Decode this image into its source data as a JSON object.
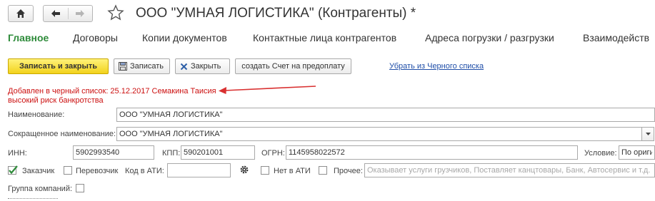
{
  "window": {
    "title": "ООО \"УМНАЯ ЛОГИСТИКА\" (Контрагенты) *"
  },
  "icons": {
    "home": "home-icon",
    "back": "arrow-left-icon",
    "forward": "arrow-right-icon",
    "favorite": "star-icon"
  },
  "tabs": [
    {
      "label": "Главное",
      "active": true
    },
    {
      "label": "Договоры",
      "active": false
    },
    {
      "label": "Копии документов",
      "active": false
    },
    {
      "label": "Контактные лица контрагентов",
      "active": false
    },
    {
      "label": "Адреса погрузки / разгрузки",
      "active": false
    },
    {
      "label": "Взаимодейств",
      "active": false
    }
  ],
  "toolbar": {
    "save_close": "Записать и закрыть",
    "save": "Записать",
    "close": "Закрыть",
    "create_invoice": "создать Счет на предоплату",
    "remove_blacklist_link": "Убрать из Черного списка"
  },
  "alerts": {
    "blacklist": "Добавлен в черный список: 25.12.2017 Семакина Таисия",
    "risk": "высокий риск банкротства"
  },
  "form": {
    "name_label": "Наименование:",
    "name_value": "ООО \"УМНАЯ ЛОГИСТИКА\"",
    "short_name_label": "Сокращенное наименование:",
    "short_name_value": "ООО \"УМНАЯ ЛОГИСТИКА\"",
    "inn_label": "ИНН:",
    "inn_value": "5902993540",
    "kpp_label": "КПП:",
    "kpp_value": "590201001",
    "ogrn_label": "ОГРН:",
    "ogrn_value": "1145958022572",
    "condition_label": "Условие:",
    "condition_value": "По ориги",
    "customer_label": "Заказчик",
    "customer_checked": true,
    "carrier_label": "Перевозчик",
    "carrier_checked": false,
    "ati_code_label": "Код в АТИ:",
    "ati_code_value": "",
    "not_in_ati_label": "Нет в АТИ",
    "not_in_ati_checked": false,
    "other_label": "Прочее:",
    "other_checked": false,
    "other_placeholder": "Оказывает услуги грузчиков, Поставляет канцтовары, Банк, Автосервис и т.д.",
    "company_group_label": "Группа компаний:",
    "company_group_checked": false
  },
  "colors": {
    "accent_green": "#2e8b3a",
    "alert_red": "#cc1111",
    "primary_yellow": "#f2d21c",
    "link_blue": "#1f4ea8"
  }
}
